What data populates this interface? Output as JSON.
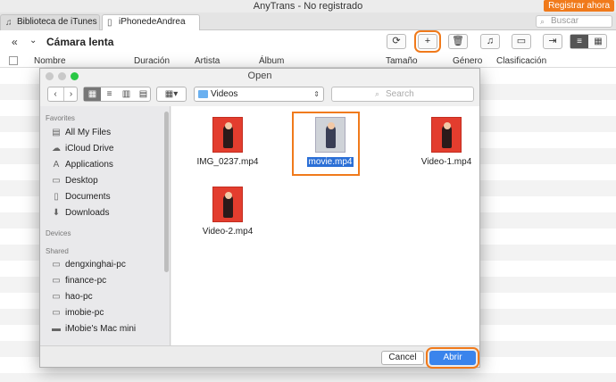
{
  "window": {
    "title": "AnyTrans - No registrado",
    "register_label": "Registrar ahora"
  },
  "tabs": [
    {
      "label": "Biblioteca de iTunes",
      "icon": "music-note-icon",
      "active": false
    },
    {
      "label": "iPhonedeAndrea",
      "icon": "iphone-icon",
      "active": true
    }
  ],
  "top_search": {
    "placeholder": "Buscar"
  },
  "toolbar": {
    "section_title": "Cámara lenta"
  },
  "columns": [
    "Nombre",
    "Duración",
    "Artista",
    "Álbum",
    "Tamaño",
    "Género",
    "Clasificación"
  ],
  "dialog": {
    "title": "Open",
    "path": "Videos",
    "search_placeholder": "Search",
    "cancel_label": "Cancel",
    "open_label": "Abrir",
    "sidebar": {
      "favorites_label": "Favorites",
      "favorites": [
        {
          "label": "All My Files",
          "icon": "all-files-icon"
        },
        {
          "label": "iCloud Drive",
          "icon": "cloud-icon"
        },
        {
          "label": "Applications",
          "icon": "applications-icon"
        },
        {
          "label": "Desktop",
          "icon": "desktop-icon"
        },
        {
          "label": "Documents",
          "icon": "documents-icon"
        },
        {
          "label": "Downloads",
          "icon": "downloads-icon"
        }
      ],
      "devices_label": "Devices",
      "shared_label": "Shared",
      "shared": [
        {
          "label": "dengxinghai-pc",
          "icon": "monitor-icon"
        },
        {
          "label": "finance-pc",
          "icon": "monitor-icon"
        },
        {
          "label": "hao-pc",
          "icon": "monitor-icon"
        },
        {
          "label": "imobie-pc",
          "icon": "monitor-icon"
        },
        {
          "label": "iMobie's Mac mini",
          "icon": "mac-mini-icon"
        }
      ]
    },
    "files": [
      {
        "name": "IMG_0237.mp4",
        "selected": false
      },
      {
        "name": "movie.mp4",
        "selected": true
      },
      {
        "name": "Video-1.mp4",
        "selected": false
      },
      {
        "name": "Video-2.mp4",
        "selected": false
      }
    ]
  }
}
